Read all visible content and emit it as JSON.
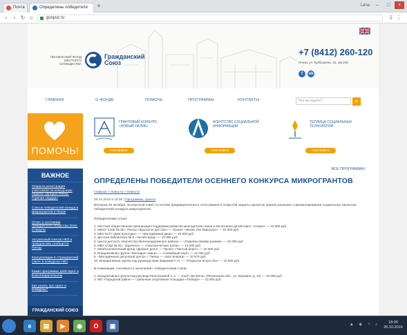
{
  "browser": {
    "tabs": [
      {
        "label": "Почта"
      },
      {
        "label": "Определены победители"
      }
    ],
    "user_label": "Lena",
    "url": "gsoyuz.ru"
  },
  "header": {
    "logo_left": "Пензенский фонд местного сообщества",
    "logo_text_1": "Гражданский",
    "logo_text_2": "Союз",
    "phone": "+7 (8412) 260-120",
    "address": "Пенза, ул. Куйбышева, 42, оф.209",
    "social": [
      "f",
      "ok"
    ]
  },
  "nav": {
    "items": [
      "Главная",
      "О фонде",
      "Помочь",
      "Программы",
      "Контакты"
    ],
    "search_placeholder": "Что вы ищете?",
    "search_icon": "search-icon"
  },
  "help": {
    "label": "ПОМОЧЬ!"
  },
  "partners": [
    {
      "name": "Грантовый конкурс «Новый облик»",
      "button": "Участвовать"
    },
    {
      "name": "Агентство социальной информации",
      "button": "Участвовать"
    },
    {
      "name": "Теплица социальных технологий",
      "button": "Участвовать"
    }
  ],
  "all_programs": "Все программы",
  "sidebar": {
    "title": "Важное",
    "items": [
      "Открыта регистрация участников на конкурсную неделю «Добрая Пенза. Горячие сердца»",
      "Список победителей конкурса микрогрантов в Пензе",
      "Отчет о состоянии гражданского общества 2016: Стимулы",
      "Актуальный список НКО и гражданских сообществ Пензы",
      "Консультации в «Гражданский союз» в конкурсах НКО",
      "Какие программы действуют в Благотворительном",
      "Как узнать про грант и конкурсы?"
    ],
    "bottom": "Гражданский союз"
  },
  "article": {
    "title": "Определены победители осеннего конкурса микрогрантов",
    "breadcrumb": "Главная » Новости » Новости",
    "date": "26.10.2016 в 18:00",
    "date_link": "Программы, гранты",
    "intro": "Вечером 25 октября, экспертный совет по итогам предварительного голосования и открытой защиты проектов принял решение о финансировании социальных проектов победителей конкурса микрогрантов.",
    "winners_head": "Победителями стали:",
    "winners": [
      "1. Местная общественная организация поддержки развития многодетной семьи и воспитания детей-сирот «Семья» — 10 000 руб.",
      "2. МБОУ СОШ № 35 г. Пензы «Крылатое детство» — Проект «Жизнь без барьеров» — 10 000 руб.",
      "3. МБУ ЕСП «Дом Культуры» — «Молодёжный двор» — 10 000 руб.",
      "4. Детская библиотека № 5 «Читай-город» — 10 000 руб.",
      "5. Центр детского творчества Железнодорожного района — «Поделки своими руками» — 10 000 руб.",
      "6. МБУ СОШ № 26 г. Заречного — «Экологическая тропа» — 10 000 руб.",
      "7. Межпоселенческий фонд «Доброе дело» — Проект «Чистый берег» — 10 000 руб.",
      "8. Инициативная группа «Молодые семьи» — «Семейный клуб» — 10 000 руб.",
      "9. «Молодёжный досуговый центр» г. Пензы — «Шаг вперёд» — 10 575 руб.",
      "10. Инициативная группа под руководством Зверевой А.Н. — «Открытое искусство» — 10 000 руб."
    ],
    "nomination_head": "В номинации «Активность населения» победителями стали:",
    "nomination": [
      "1. Инициативная группа под руководством Кузиной С.А. — Клуб «Встреча» (Пензенская обл., ул. Баумана, д. 10) — 10 000 руб.",
      "2. МО «Городской район» — районная спортивная площадка «Победа» — 10 000 руб."
    ]
  },
  "taskbar": {
    "time": "18:00",
    "date": "26.10.2016"
  },
  "colors": {
    "brand_blue": "#1d4f95",
    "sidebar_blue": "#1f4f8e",
    "accent_orange": "#f5a21c"
  }
}
